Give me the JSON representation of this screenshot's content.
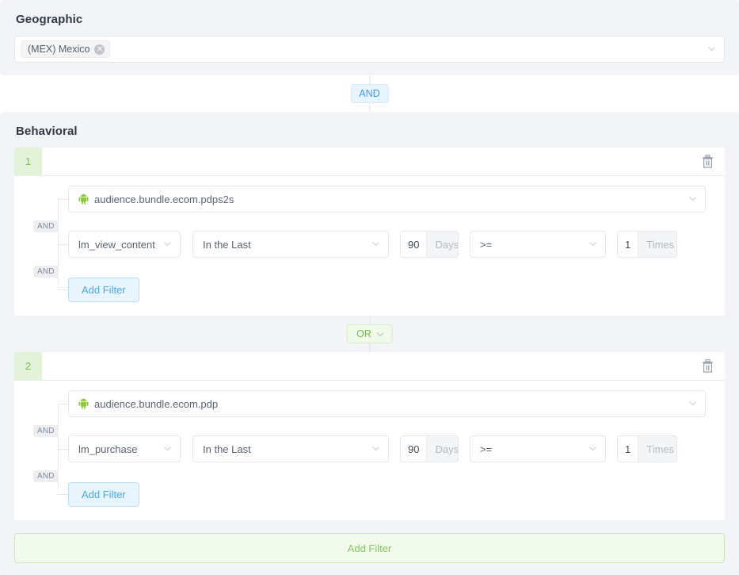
{
  "geographic": {
    "title": "Geographic",
    "select": {
      "tags": [
        {
          "label": "(MEX) Mexico",
          "close": "✕"
        }
      ],
      "chevron_icon": "chevron-down-icon"
    }
  },
  "connector_top": {
    "label": "AND",
    "type": "and",
    "has_chevron": false
  },
  "behavioral": {
    "title": "Behavioral",
    "blocks": [
      {
        "number": "1",
        "delete_icon": "trash-icon",
        "app": {
          "platform_icon": "android-icon",
          "label": "audience.bundle.ecom.pdps2s"
        },
        "connector_labels": [
          "AND",
          "AND"
        ],
        "filter": {
          "event": "lm_view_content",
          "timeframe": "In the Last",
          "duration_value": "90",
          "duration_unit": "Days",
          "operator": ">=",
          "count_value": "1",
          "count_unit": "Times"
        },
        "add_filter_label": "Add Filter"
      },
      {
        "number": "2",
        "delete_icon": "trash-icon",
        "app": {
          "platform_icon": "android-icon",
          "label": "audience.bundle.ecom.pdp"
        },
        "connector_labels": [
          "AND",
          "AND"
        ],
        "filter": {
          "event": "lm_purchase",
          "timeframe": "In the Last",
          "duration_value": "90",
          "duration_unit": "Days",
          "operator": ">=",
          "count_value": "1",
          "count_unit": "Times"
        },
        "add_filter_label": "Add Filter"
      }
    ],
    "block_connector": {
      "label": "OR",
      "type": "or",
      "has_chevron": true
    },
    "add_filter_label": "Add Filter"
  },
  "colors": {
    "panel_bg": "#f2f4f8",
    "and_accent": "#3b9cf5",
    "or_accent": "#74c043",
    "number_badge_bg": "#e3f3d9",
    "number_badge_text": "#7ac142",
    "android_green": "#8dc63f"
  }
}
